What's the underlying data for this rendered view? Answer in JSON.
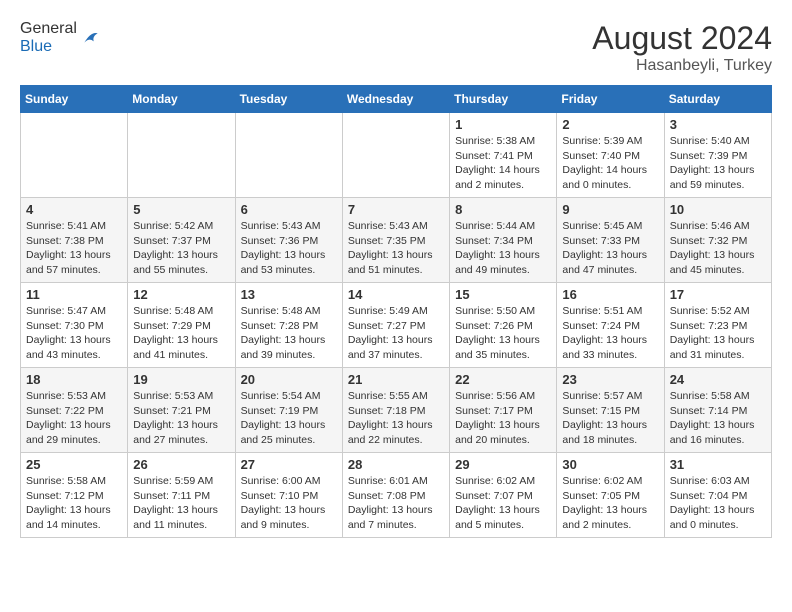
{
  "header": {
    "logo_general": "General",
    "logo_blue": "Blue",
    "month_year": "August 2024",
    "location": "Hasanbeyli, Turkey"
  },
  "weekdays": [
    "Sunday",
    "Monday",
    "Tuesday",
    "Wednesday",
    "Thursday",
    "Friday",
    "Saturday"
  ],
  "weeks": [
    [
      {
        "day": "",
        "info": ""
      },
      {
        "day": "",
        "info": ""
      },
      {
        "day": "",
        "info": ""
      },
      {
        "day": "",
        "info": ""
      },
      {
        "day": "1",
        "info": "Sunrise: 5:38 AM\nSunset: 7:41 PM\nDaylight: 14 hours\nand 2 minutes."
      },
      {
        "day": "2",
        "info": "Sunrise: 5:39 AM\nSunset: 7:40 PM\nDaylight: 14 hours\nand 0 minutes."
      },
      {
        "day": "3",
        "info": "Sunrise: 5:40 AM\nSunset: 7:39 PM\nDaylight: 13 hours\nand 59 minutes."
      }
    ],
    [
      {
        "day": "4",
        "info": "Sunrise: 5:41 AM\nSunset: 7:38 PM\nDaylight: 13 hours\nand 57 minutes."
      },
      {
        "day": "5",
        "info": "Sunrise: 5:42 AM\nSunset: 7:37 PM\nDaylight: 13 hours\nand 55 minutes."
      },
      {
        "day": "6",
        "info": "Sunrise: 5:43 AM\nSunset: 7:36 PM\nDaylight: 13 hours\nand 53 minutes."
      },
      {
        "day": "7",
        "info": "Sunrise: 5:43 AM\nSunset: 7:35 PM\nDaylight: 13 hours\nand 51 minutes."
      },
      {
        "day": "8",
        "info": "Sunrise: 5:44 AM\nSunset: 7:34 PM\nDaylight: 13 hours\nand 49 minutes."
      },
      {
        "day": "9",
        "info": "Sunrise: 5:45 AM\nSunset: 7:33 PM\nDaylight: 13 hours\nand 47 minutes."
      },
      {
        "day": "10",
        "info": "Sunrise: 5:46 AM\nSunset: 7:32 PM\nDaylight: 13 hours\nand 45 minutes."
      }
    ],
    [
      {
        "day": "11",
        "info": "Sunrise: 5:47 AM\nSunset: 7:30 PM\nDaylight: 13 hours\nand 43 minutes."
      },
      {
        "day": "12",
        "info": "Sunrise: 5:48 AM\nSunset: 7:29 PM\nDaylight: 13 hours\nand 41 minutes."
      },
      {
        "day": "13",
        "info": "Sunrise: 5:48 AM\nSunset: 7:28 PM\nDaylight: 13 hours\nand 39 minutes."
      },
      {
        "day": "14",
        "info": "Sunrise: 5:49 AM\nSunset: 7:27 PM\nDaylight: 13 hours\nand 37 minutes."
      },
      {
        "day": "15",
        "info": "Sunrise: 5:50 AM\nSunset: 7:26 PM\nDaylight: 13 hours\nand 35 minutes."
      },
      {
        "day": "16",
        "info": "Sunrise: 5:51 AM\nSunset: 7:24 PM\nDaylight: 13 hours\nand 33 minutes."
      },
      {
        "day": "17",
        "info": "Sunrise: 5:52 AM\nSunset: 7:23 PM\nDaylight: 13 hours\nand 31 minutes."
      }
    ],
    [
      {
        "day": "18",
        "info": "Sunrise: 5:53 AM\nSunset: 7:22 PM\nDaylight: 13 hours\nand 29 minutes."
      },
      {
        "day": "19",
        "info": "Sunrise: 5:53 AM\nSunset: 7:21 PM\nDaylight: 13 hours\nand 27 minutes."
      },
      {
        "day": "20",
        "info": "Sunrise: 5:54 AM\nSunset: 7:19 PM\nDaylight: 13 hours\nand 25 minutes."
      },
      {
        "day": "21",
        "info": "Sunrise: 5:55 AM\nSunset: 7:18 PM\nDaylight: 13 hours\nand 22 minutes."
      },
      {
        "day": "22",
        "info": "Sunrise: 5:56 AM\nSunset: 7:17 PM\nDaylight: 13 hours\nand 20 minutes."
      },
      {
        "day": "23",
        "info": "Sunrise: 5:57 AM\nSunset: 7:15 PM\nDaylight: 13 hours\nand 18 minutes."
      },
      {
        "day": "24",
        "info": "Sunrise: 5:58 AM\nSunset: 7:14 PM\nDaylight: 13 hours\nand 16 minutes."
      }
    ],
    [
      {
        "day": "25",
        "info": "Sunrise: 5:58 AM\nSunset: 7:12 PM\nDaylight: 13 hours\nand 14 minutes."
      },
      {
        "day": "26",
        "info": "Sunrise: 5:59 AM\nSunset: 7:11 PM\nDaylight: 13 hours\nand 11 minutes."
      },
      {
        "day": "27",
        "info": "Sunrise: 6:00 AM\nSunset: 7:10 PM\nDaylight: 13 hours\nand 9 minutes."
      },
      {
        "day": "28",
        "info": "Sunrise: 6:01 AM\nSunset: 7:08 PM\nDaylight: 13 hours\nand 7 minutes."
      },
      {
        "day": "29",
        "info": "Sunrise: 6:02 AM\nSunset: 7:07 PM\nDaylight: 13 hours\nand 5 minutes."
      },
      {
        "day": "30",
        "info": "Sunrise: 6:02 AM\nSunset: 7:05 PM\nDaylight: 13 hours\nand 2 minutes."
      },
      {
        "day": "31",
        "info": "Sunrise: 6:03 AM\nSunset: 7:04 PM\nDaylight: 13 hours\nand 0 minutes."
      }
    ]
  ]
}
